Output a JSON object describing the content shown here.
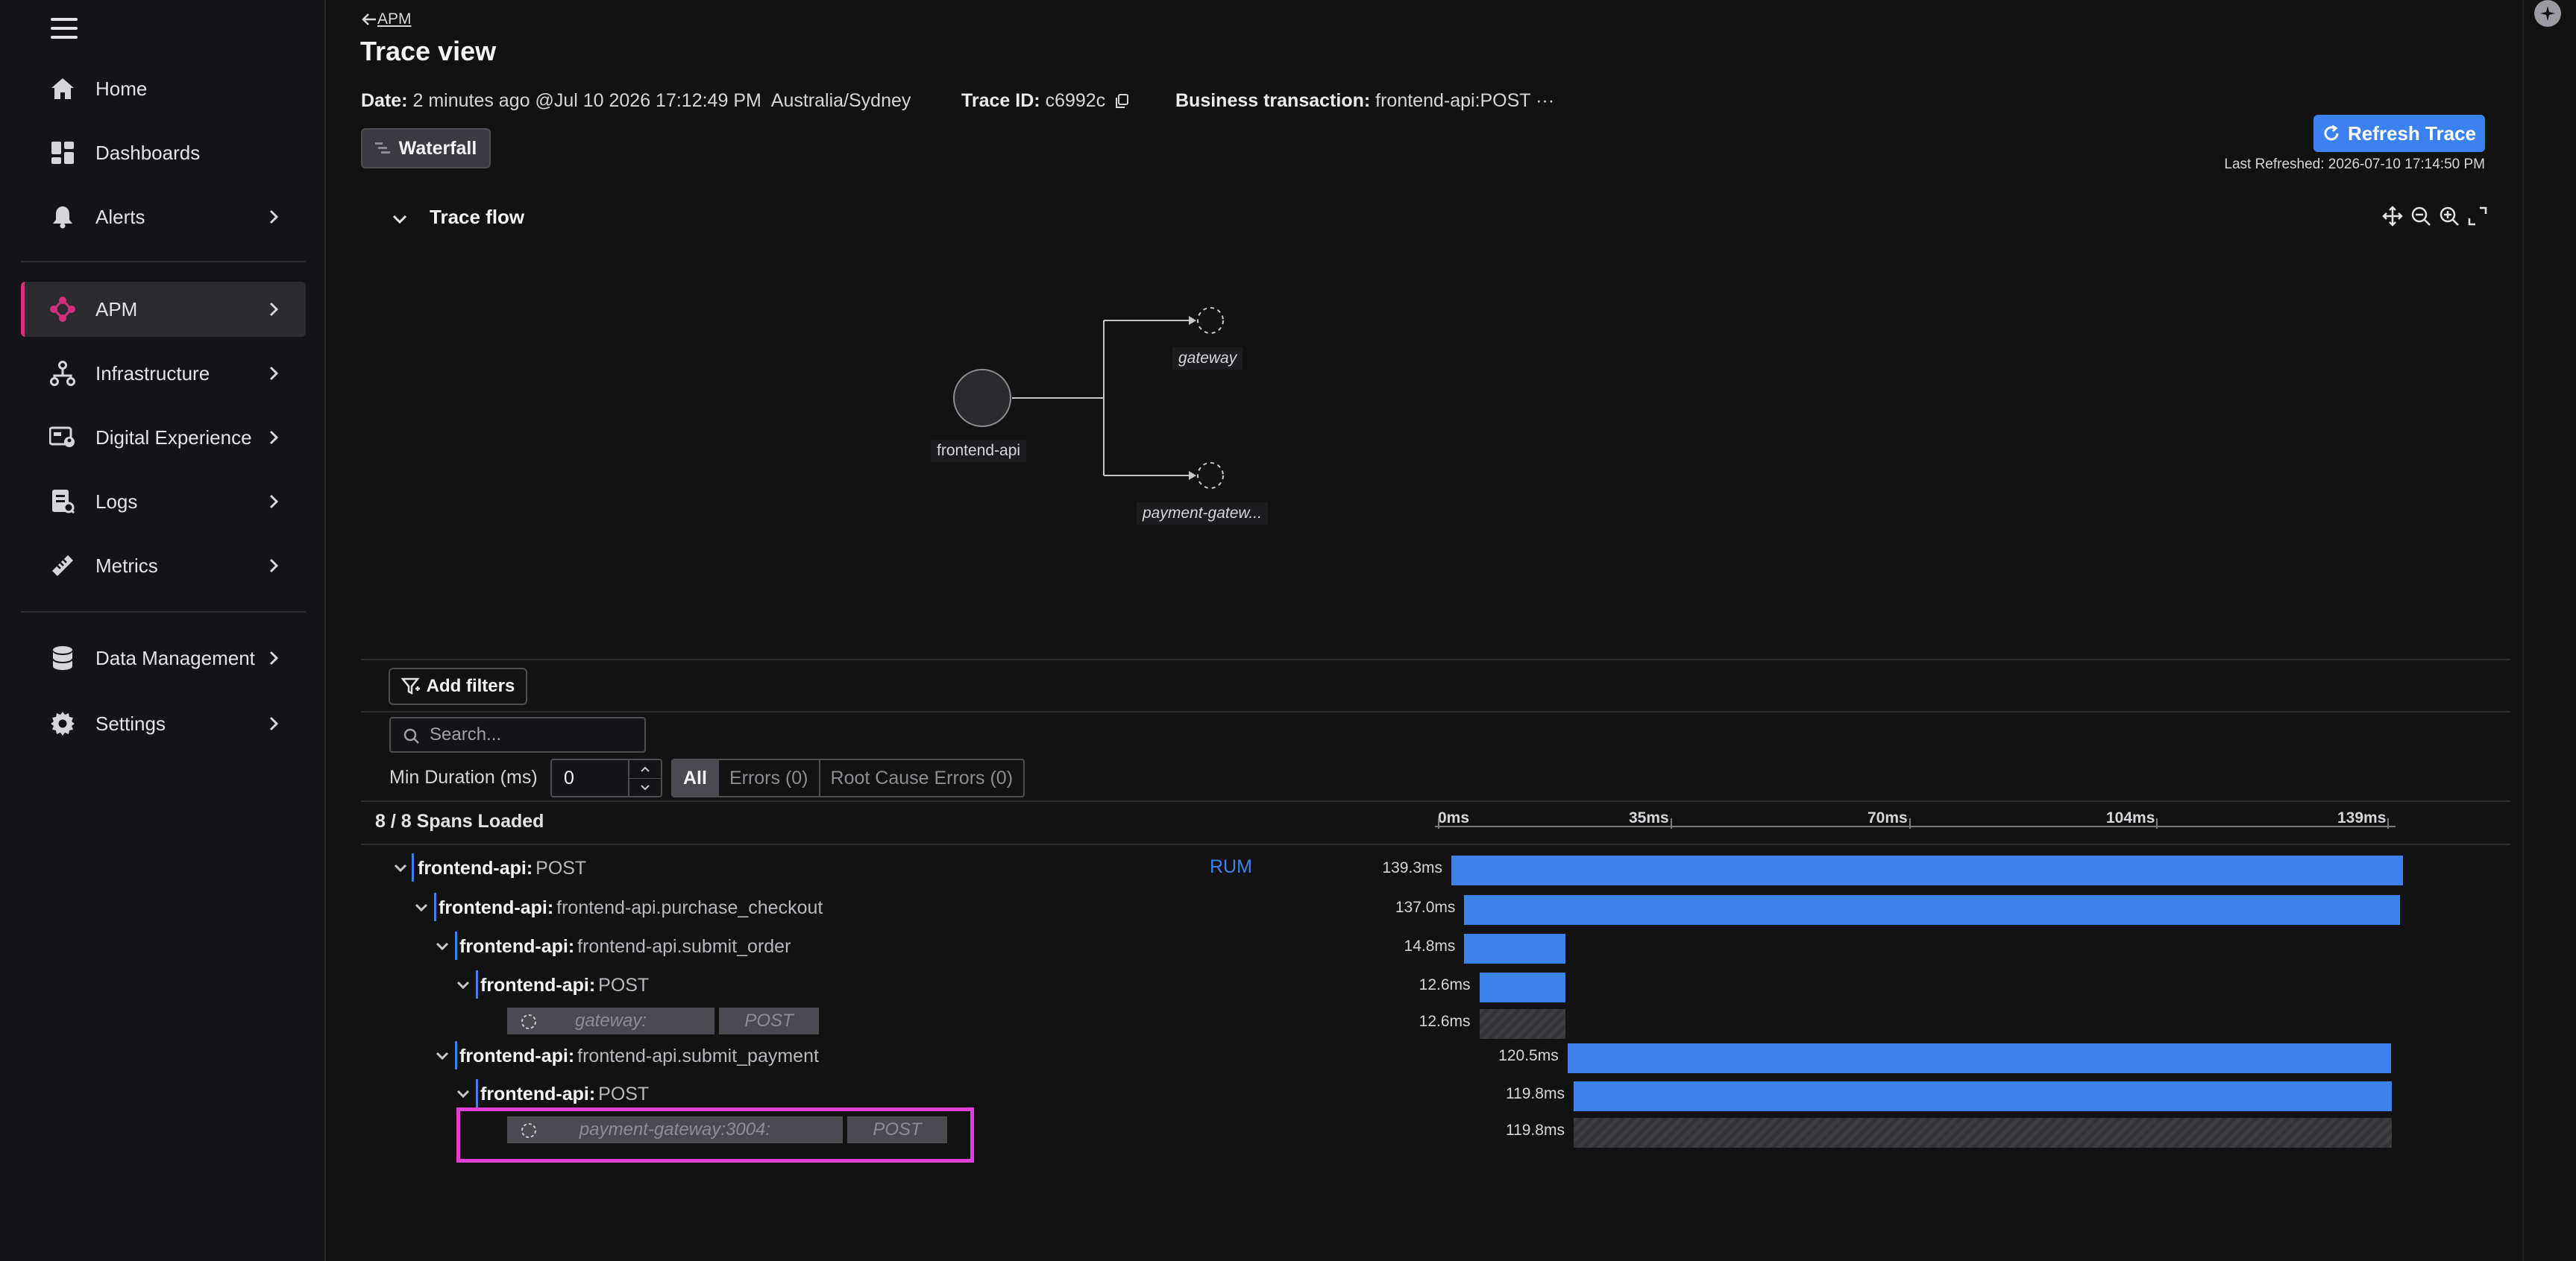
{
  "sidebar": {
    "menu_icon": "hamburger-icon",
    "items": [
      {
        "label": "Home",
        "icon": "home-icon"
      },
      {
        "label": "Dashboards",
        "icon": "dashboards-icon"
      },
      {
        "label": "Alerts",
        "icon": "bell-icon"
      },
      {
        "label": "APM",
        "icon": "apm-icon"
      },
      {
        "label": "Infrastructure",
        "icon": "infrastructure-icon"
      },
      {
        "label": "Digital Experience",
        "icon": "digital-experience-icon"
      },
      {
        "label": "Logs",
        "icon": "logs-icon"
      },
      {
        "label": "Metrics",
        "icon": "metrics-icon"
      },
      {
        "label": "Data Management",
        "icon": "database-icon"
      },
      {
        "label": "Settings",
        "icon": "gear-icon"
      }
    ],
    "active": "APM",
    "active_color": "#d4307e"
  },
  "header": {
    "back_label": "APM",
    "title": "Trace view",
    "date_label": "Date:",
    "date_value": "2 minutes ago @Jul 10 2026 17:12:49 PM",
    "timezone": "Australia/Sydney",
    "trace_id_label": "Trace ID:",
    "trace_id_value": "c6992c",
    "business_label": "Business transaction:",
    "business_value": "frontend-api:POST",
    "business_more": "···",
    "view_mode": "Waterfall",
    "refresh_label": "Refresh Trace",
    "last_refreshed": "Last Refreshed: 2026-07-10 17:14:50 PM"
  },
  "trace_flow": {
    "title": "Trace flow",
    "tools": [
      "pan-icon",
      "zoom-out-icon",
      "zoom-in-icon",
      "fit-screen-icon"
    ],
    "nodes": [
      {
        "label": "frontend-api"
      },
      {
        "label": "gateway"
      },
      {
        "label": "payment-gatew..."
      }
    ]
  },
  "filters": {
    "add_filters": "Add filters",
    "search_placeholder": "Search...",
    "min_duration_label": "Min Duration (ms)",
    "min_duration_value": "0",
    "tabs": [
      "All",
      "Errors (0)",
      "Root Cause Errors (0)"
    ],
    "active_tab": "All"
  },
  "spans_loaded": "8 / 8 Spans Loaded",
  "axis_ticks": [
    "0ms",
    "35ms",
    "70ms",
    "104ms",
    "139ms"
  ],
  "axis_max_ms": 139.3,
  "rum_label": "RUM",
  "spans": [
    {
      "service": "frontend-api:",
      "op": "POST",
      "duration": "139.3ms",
      "start_ms": 0.0,
      "dur_ms": 139.3,
      "depth": 0
    },
    {
      "service": "frontend-api:",
      "op": "frontend-api.purchase_checkout",
      "duration": "137.0ms",
      "start_ms": 1.9,
      "dur_ms": 137.0,
      "depth": 1
    },
    {
      "service": "frontend-api:",
      "op": "frontend-api.submit_order",
      "duration": "14.8ms",
      "start_ms": 1.9,
      "dur_ms": 14.8,
      "depth": 2
    },
    {
      "service": "frontend-api:",
      "op": "POST",
      "duration": "12.6ms",
      "start_ms": 4.1,
      "dur_ms": 12.6,
      "depth": 3
    },
    {
      "remote": "gateway:",
      "method": "POST",
      "duration": "12.6ms",
      "start_ms": 4.1,
      "dur_ms": 12.6,
      "depth": 4
    },
    {
      "service": "frontend-api:",
      "op": "frontend-api.submit_payment",
      "duration": "120.5ms",
      "start_ms": 17.0,
      "dur_ms": 120.5,
      "depth": 2
    },
    {
      "service": "frontend-api:",
      "op": "POST",
      "duration": "119.8ms",
      "start_ms": 17.9,
      "dur_ms": 119.8,
      "depth": 3
    },
    {
      "remote": "payment-gateway:3004:",
      "method": "POST",
      "duration": "119.8ms",
      "start_ms": 17.9,
      "dur_ms": 119.8,
      "depth": 4
    }
  ],
  "colors": {
    "bar": "#3c82e8",
    "accent": "#3b82f0",
    "highlight": "#e040d8"
  }
}
